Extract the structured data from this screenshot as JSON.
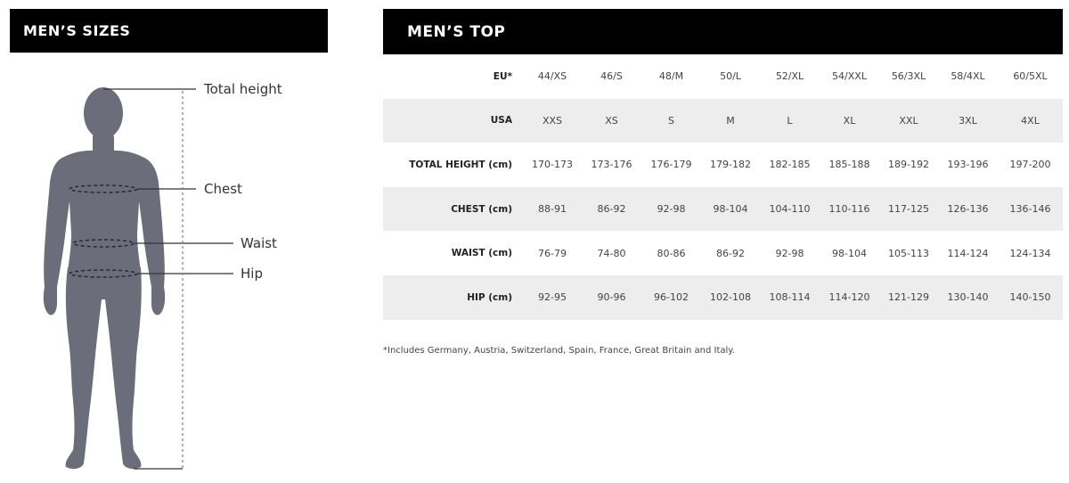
{
  "left_panel": {
    "title": "MEN’S SIZES",
    "labels": {
      "total_height": "Total height",
      "chest": "Chest",
      "waist": "Waist",
      "hip": "Hip"
    },
    "figure_color": "#6b6d7a"
  },
  "right_panel": {
    "title": "MEN’S TOP",
    "rows": [
      {
        "header": "EU*",
        "values": [
          "44/XS",
          "46/S",
          "48/M",
          "50/L",
          "52/XL",
          "54/XXL",
          "56/3XL",
          "58/4XL",
          "60/5XL"
        ]
      },
      {
        "header": "USA",
        "values": [
          "XXS",
          "XS",
          "S",
          "M",
          "L",
          "XL",
          "XXL",
          "3XL",
          "4XL"
        ]
      },
      {
        "header": "TOTAL HEIGHT (cm)",
        "values": [
          "170-173",
          "173-176",
          "176-179",
          "179-182",
          "182-185",
          "185-188",
          "189-192",
          "193-196",
          "197-200"
        ]
      },
      {
        "header": "CHEST (cm)",
        "values": [
          "88-91",
          "86-92",
          "92-98",
          "98-104",
          "104-110",
          "110-116",
          "117-125",
          "126-136",
          "136-146"
        ]
      },
      {
        "header": "WAIST (cm)",
        "values": [
          "76-79",
          "74-80",
          "80-86",
          "86-92",
          "92-98",
          "98-104",
          "105-113",
          "114-124",
          "124-134"
        ]
      },
      {
        "header": "HIP (cm)",
        "values": [
          "92-95",
          "90-96",
          "96-102",
          "102-108",
          "108-114",
          "114-120",
          "121-129",
          "130-140",
          "140-150"
        ]
      }
    ],
    "footnote": "*Includes Germany, Austria, Switzerland, Spain, France, Great Britain and Italy.",
    "shade_color": "#ededed"
  }
}
